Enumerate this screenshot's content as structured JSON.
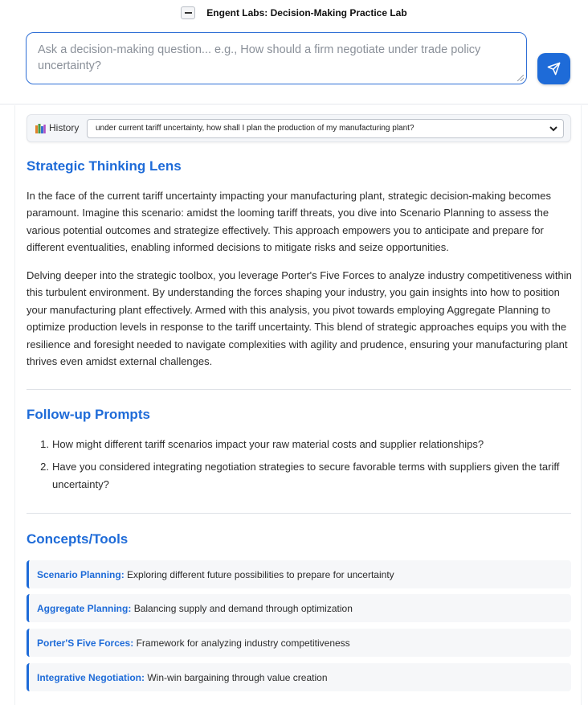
{
  "header": {
    "collapse_label": "−",
    "title": "Engent Labs: Decision-Making Practice Lab"
  },
  "query": {
    "placeholder": "Ask a decision-making question... e.g., How should a firm negotiate under trade policy uncertainty?"
  },
  "history": {
    "label": "History",
    "selected": "under current tariff uncertainty, how shall I plan the production of my manufacturing plant?"
  },
  "strategic": {
    "heading": "Strategic Thinking Lens",
    "paragraphs": [
      "In the face of the current tariff uncertainty impacting your manufacturing plant, strategic decision-making becomes paramount. Imagine this scenario: amidst the looming tariff threats, you dive into Scenario Planning to assess the various potential outcomes and strategize effectively. This approach empowers you to anticipate and prepare for different eventualities, enabling informed decisions to mitigate risks and seize opportunities.",
      "Delving deeper into the strategic toolbox, you leverage Porter's Five Forces to analyze industry competitiveness within this turbulent environment. By understanding the forces shaping your industry, you gain insights into how to position your manufacturing plant effectively. Armed with this analysis, you pivot towards employing Aggregate Planning to optimize production levels in response to the tariff uncertainty. This blend of strategic approaches equips you with the resilience and foresight needed to navigate complexities with agility and prudence, ensuring your manufacturing plant thrives even amidst external challenges."
    ]
  },
  "followup": {
    "heading": "Follow-up Prompts",
    "items": [
      {
        "num": "1.",
        "text": "How might different tariff scenarios impact your raw material costs and supplier relationships?"
      },
      {
        "num": "2.",
        "text": "Have you considered integrating negotiation strategies to secure favorable terms with suppliers given the tariff uncertainty?"
      }
    ]
  },
  "concepts": {
    "heading": "Concepts/Tools",
    "items": [
      {
        "name": "Scenario Planning:",
        "desc": "Exploring different future possibilities to prepare for uncertainty"
      },
      {
        "name": "Aggregate Planning:",
        "desc": "Balancing supply and demand through optimization"
      },
      {
        "name": "Porter'S Five Forces:",
        "desc": "Framework for analyzing industry competitiveness"
      },
      {
        "name": "Integrative Negotiation:",
        "desc": "Win-win bargaining through value creation"
      }
    ]
  },
  "colors": {
    "accent": "#1e6bd8",
    "text": "#2b2b2b",
    "divider": "#dfe2e7"
  }
}
